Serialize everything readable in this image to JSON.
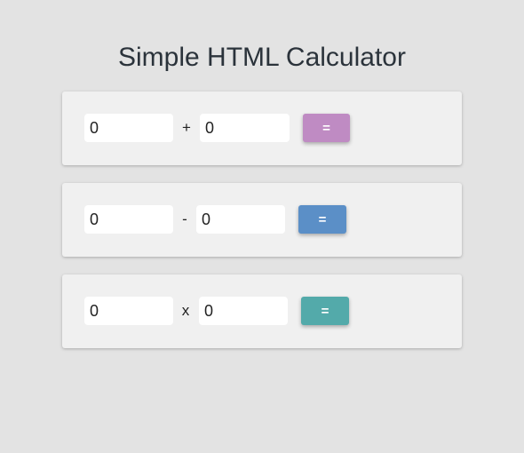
{
  "page": {
    "title": "Simple HTML Calculator"
  },
  "addition": {
    "a_value": "0",
    "operator": "+",
    "b_value": "0",
    "equals_label": "=",
    "button_color": "#bf8bc3"
  },
  "subtraction": {
    "a_value": "0",
    "operator": "-",
    "b_value": "0",
    "equals_label": "=",
    "button_color": "#5b8fc7"
  },
  "multiplication": {
    "a_value": "0",
    "operator": "x",
    "b_value": "0",
    "equals_label": "=",
    "button_color": "#53aaaa"
  }
}
